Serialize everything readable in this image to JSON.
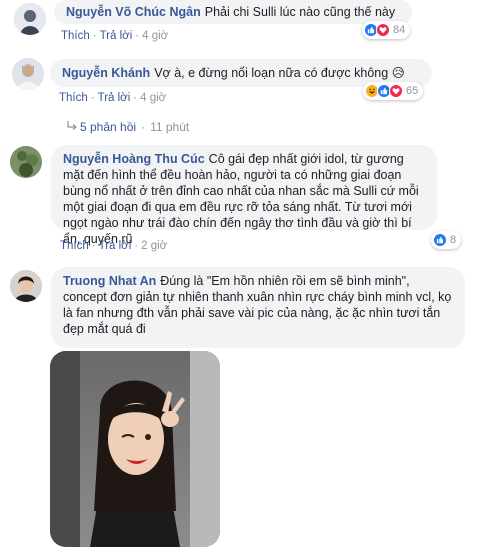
{
  "comments": [
    {
      "author": "Nguyễn Võ Chúc Ngân",
      "text": "Phải chi Sulli lúc nào cũng thế này",
      "like_label": "Thích",
      "reply_label": "Trả lời",
      "time": "4 giờ",
      "reaction_count": "84",
      "reaction_icons": [
        "like-icon",
        "love-icon"
      ]
    },
    {
      "author": "Nguyễn Khánh",
      "text": "Vợ à, e đừng nổi loạn nữa có được không",
      "emoji": "😥",
      "like_label": "Thích",
      "reply_label": "Trả lời",
      "time": "4 giờ",
      "reaction_count": "65",
      "reaction_icons": [
        "haha-icon",
        "like-icon",
        "love-icon"
      ]
    },
    {
      "author": "Nguyễn Hoàng Thu Cúc",
      "text": "Cô gái đẹp nhất giới idol, từ gương mặt đến hình thể đều hoàn hảo, người ta có những giai đoạn bùng nổ nhất ở trên đỉnh cao nhất của nhan sắc mà Sulli cứ mỗi một giai đoạn đi qua em đều rực rỡ tỏa sáng nhất. Từ tươi mới ngọt ngào như trái đào chín đến ngây thơ tình đầu và giờ thì bí ẩn, quyến rũ",
      "like_label": "Thích",
      "reply_label": "Trả lời",
      "time": "2 giờ",
      "reaction_count": "8",
      "reaction_icons": [
        "like-icon"
      ]
    },
    {
      "author": "Truong Nhat An",
      "text": "Đúng là \"Em hồn nhiên rồi em sẽ bình minh\", concept đơn giản tự nhiên thanh xuân nhìn rực cháy bình minh vcl, kọ là fan nhưng đth vẫn phải save vài pic của nàng, ặc ặc nhìn tươi tắn đẹp mắt quá đi"
    }
  ],
  "replies_link": {
    "label": "5 phản hồi",
    "separator": "·",
    "time": "11 phút"
  },
  "separator": "·",
  "colors": {
    "author": "#385898",
    "bubble": "#f2f3f5",
    "like": "#2078f4",
    "love": "#f0284a",
    "haha": "#f7b125"
  }
}
